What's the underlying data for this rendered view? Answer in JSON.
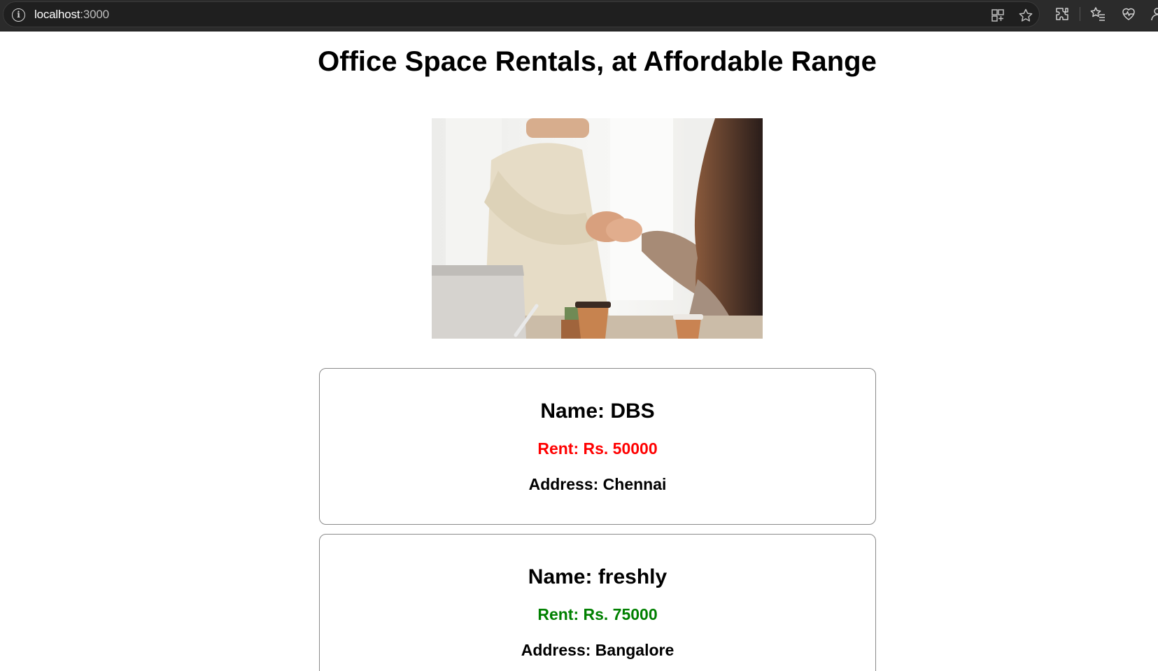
{
  "browser": {
    "url_host": "localhost",
    "url_port": ":3000",
    "icons": [
      "info-icon",
      "grid-icon",
      "star-icon",
      "extensions-icon",
      "favorites-icon",
      "health-icon",
      "profile-icon"
    ]
  },
  "page": {
    "title": "Office Space Rentals, at Affordable Range",
    "hero_image": "handshake-office-photo"
  },
  "offices": [
    {
      "name": "Name: DBS",
      "rent": "Rent: Rs. 50000",
      "address": "Address: Chennai",
      "rent_color": "#ff0000"
    },
    {
      "name": "Name: freshly",
      "rent": "Rent: Rs. 75000",
      "address": "Address: Bangalore",
      "rent_color": "#008000"
    }
  ]
}
